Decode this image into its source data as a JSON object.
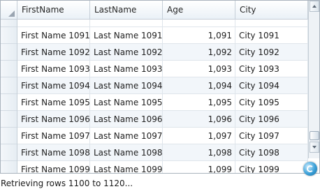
{
  "columns": [
    "FirstName",
    "LastName",
    "Age",
    "City"
  ],
  "rows": [
    {
      "first": "First Name 1091",
      "last": "Last Name 1091",
      "age": "1,091",
      "city": "City 1091"
    },
    {
      "first": "First Name 1092",
      "last": "Last Name 1092",
      "age": "1,092",
      "city": "City 1092"
    },
    {
      "first": "First Name 1093",
      "last": "Last Name 1093",
      "age": "1,093",
      "city": "City 1093"
    },
    {
      "first": "First Name 1094",
      "last": "Last Name 1094",
      "age": "1,094",
      "city": "City 1094"
    },
    {
      "first": "First Name 1095",
      "last": "Last Name 1095",
      "age": "1,095",
      "city": "City 1095"
    },
    {
      "first": "First Name 1096",
      "last": "Last Name 1096",
      "age": "1,096",
      "city": "City 1096"
    },
    {
      "first": "First Name 1097",
      "last": "Last Name 1097",
      "age": "1,097",
      "city": "City 1097"
    },
    {
      "first": "First Name 1098",
      "last": "Last Name 1098",
      "age": "1,098",
      "city": "City 1098"
    },
    {
      "first": "First Name 1099",
      "last": "Last Name 1099",
      "age": "1,099",
      "city": "City 1099"
    }
  ],
  "status": "Retrieving rows 1100 to 1120..."
}
